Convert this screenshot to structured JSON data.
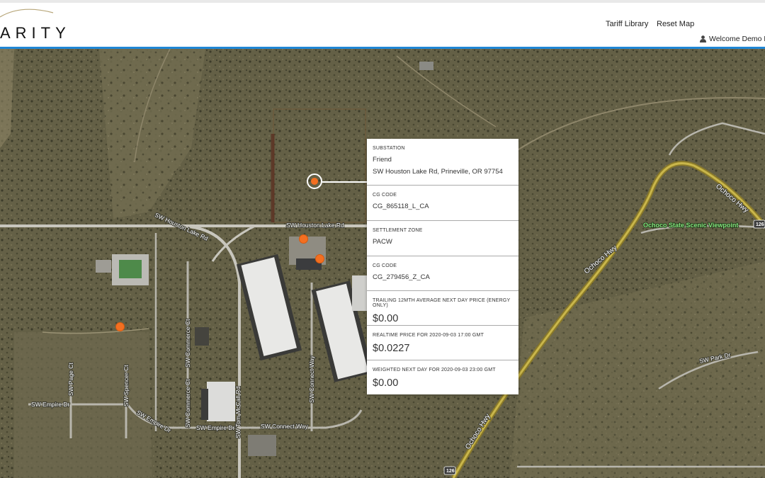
{
  "header": {
    "brand": "ARITY",
    "nav": [
      {
        "label": "Tariff Library"
      },
      {
        "label": "Reset Map"
      }
    ],
    "user_label": "Welcome Demo Pr"
  },
  "map": {
    "road_labels": {
      "houston_lake_main": "SW Houston Lake Rd",
      "houston_lake_east": "SW Houston Lake Rd",
      "tom_mccall": "SW Tom McCall Rd",
      "connect_way_vertical": "SW Connect Way",
      "connect_way": "SW Connect Way",
      "commerce_ct_1": "SW Commerce Ct",
      "commerce_ct_2": "SW Commerce Ct",
      "empire_dr_1": "SW Empire Dr",
      "empire_dr_2": "SW Empire Dr",
      "empire_dr_3": "SW Empire Dr",
      "page_ct": "SW Page Ct",
      "spencer_ct": "SW Spencer Ct",
      "park_dr": "SW Park Dr",
      "ochoco_hwy_1": "Ochoco Hwy",
      "ochoco_hwy_2": "Ochoco Hwy",
      "ochoco_hwy_3": "Ochoco Hwy"
    },
    "poi": "Ochoco State Scenic Viewpoint",
    "shields": [
      "126",
      "126"
    ]
  },
  "popup": {
    "substation_label": "SUBSTATION",
    "substation_name": "Friend",
    "substation_address": "SW Houston Lake Rd, Prineville, OR 97754",
    "cg_code_label_1": "CG CODE",
    "cg_code_1": "CG_865118_L_CA",
    "settlement_label": "SETTLEMENT ZONE",
    "settlement_zone": "PACW",
    "cg_code_label_2": "CG CODE",
    "cg_code_2": "CG_279456_Z_CA",
    "trailing_label": "TRAILING 12mth AVERAGE NEXT DAY PRICE (Energy only)",
    "trailing_value": "$0.00",
    "realtime_label": "REALTIME PRICE FOR 2020-09-03 17:00 GMT",
    "realtime_value": "$0.0227",
    "weighted_label": "WEIGHTED NEXT DAY FOR 2020-09-03 23:00 GMT",
    "weighted_value": "$0.00"
  },
  "colors": {
    "accent": "#1f87d6",
    "marker": "#f36f21"
  }
}
